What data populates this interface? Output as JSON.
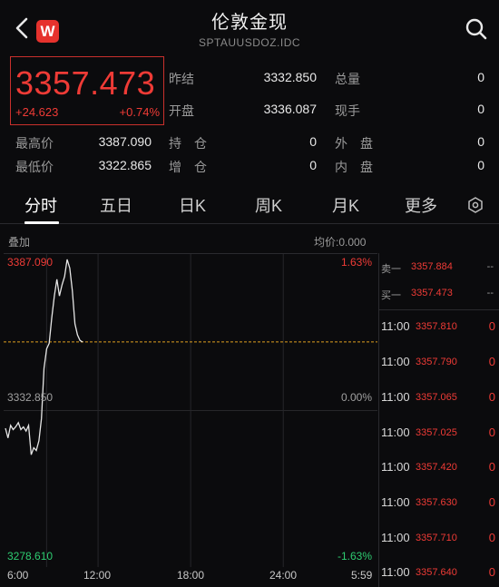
{
  "header": {
    "back_icon": "chevron-left-icon",
    "logo_letter": "W",
    "title": "伦敦金现",
    "subtitle": "SPTAUUSDOZ.IDC",
    "search_icon": "search-icon"
  },
  "quote": {
    "price": "3357.473",
    "change": "+24.623",
    "change_pct": "+0.74%"
  },
  "stats": {
    "prev_close_label": "昨结",
    "prev_close": "3332.850",
    "total_vol_label": "总量",
    "total_vol": "0",
    "open_label": "开盘",
    "open": "3336.087",
    "cur_vol_label": "现手",
    "cur_vol": "0",
    "high_label": "最高价",
    "high": "3387.090",
    "hold_label": "持　仓",
    "hold": "0",
    "outer_label": "外　盘",
    "outer": "0",
    "low_label": "最低价",
    "low": "3322.865",
    "inc_label": "增　仓",
    "inc": "0",
    "inner_label": "内　盘",
    "inner": "0"
  },
  "tabs": [
    {
      "label": "分时"
    },
    {
      "label": "五日"
    },
    {
      "label": "日K"
    },
    {
      "label": "周K"
    },
    {
      "label": "月K"
    },
    {
      "label": "更多"
    }
  ],
  "chart_meta": {
    "overlay_label": "叠加",
    "avg_label": "均价:0.000",
    "top_price": "3387.090",
    "mid_price": "3332.850",
    "bottom_price": "3278.610",
    "top_pct": "1.63%",
    "mid_pct": "0.00%",
    "bottom_pct": "-1.63%",
    "time_labels": [
      "6:00",
      "12:00",
      "18:00",
      "24:00",
      "5:59"
    ]
  },
  "orderbook": {
    "sell1_label": "卖一",
    "sell1_price": "3357.884",
    "sell1_vol": "--",
    "buy1_label": "买一",
    "buy1_price": "3357.473",
    "buy1_vol": "--"
  },
  "ticks": [
    {
      "time": "11:00",
      "price": "3357.810",
      "vol": "0"
    },
    {
      "time": "11:00",
      "price": "3357.790",
      "vol": "0"
    },
    {
      "time": "11:00",
      "price": "3357.065",
      "vol": "0"
    },
    {
      "time": "11:00",
      "price": "3357.025",
      "vol": "0"
    },
    {
      "time": "11:00",
      "price": "3357.420",
      "vol": "0"
    },
    {
      "time": "11:00",
      "price": "3357.630",
      "vol": "0"
    },
    {
      "time": "11:00",
      "price": "3357.710",
      "vol": "0"
    },
    {
      "time": "11:00",
      "price": "3357.640",
      "vol": "0"
    }
  ],
  "colors": {
    "up": "#ef3b36",
    "down": "#2ecc71",
    "line": "#e6e6e6",
    "ref": "#e0a020"
  },
  "chart_data": {
    "type": "line",
    "title": "",
    "xlabel": "",
    "ylabel": "",
    "ylim": [
      3278.61,
      3387.09
    ],
    "reference": 3332.85,
    "x_ticks": [
      "6:00",
      "12:00",
      "18:00",
      "24:00",
      "5:59"
    ],
    "series": [
      {
        "name": "",
        "x": [
          "6:00",
          "6:10",
          "6:20",
          "6:30",
          "6:40",
          "6:50",
          "7:00",
          "7:10",
          "7:20",
          "7:30",
          "7:40",
          "7:50",
          "8:00",
          "8:10",
          "8:20",
          "8:30",
          "8:40",
          "8:50",
          "9:00",
          "9:10",
          "9:20",
          "9:30",
          "9:40",
          "9:50",
          "10:00",
          "10:10",
          "10:20",
          "10:30",
          "10:40",
          "10:50",
          "11:00"
        ],
        "values": [
          3326.5,
          3323.0,
          3327.5,
          3326.0,
          3327.0,
          3328.5,
          3326.0,
          3327.0,
          3325.5,
          3327.5,
          3317.0,
          3319.5,
          3318.5,
          3322.0,
          3330.0,
          3348.0,
          3355.0,
          3357.0,
          3366.0,
          3374.0,
          3380.0,
          3374.0,
          3378.0,
          3381.0,
          3387.09,
          3384.0,
          3376.0,
          3364.0,
          3360.0,
          3358.0,
          3357.47
        ]
      }
    ]
  }
}
